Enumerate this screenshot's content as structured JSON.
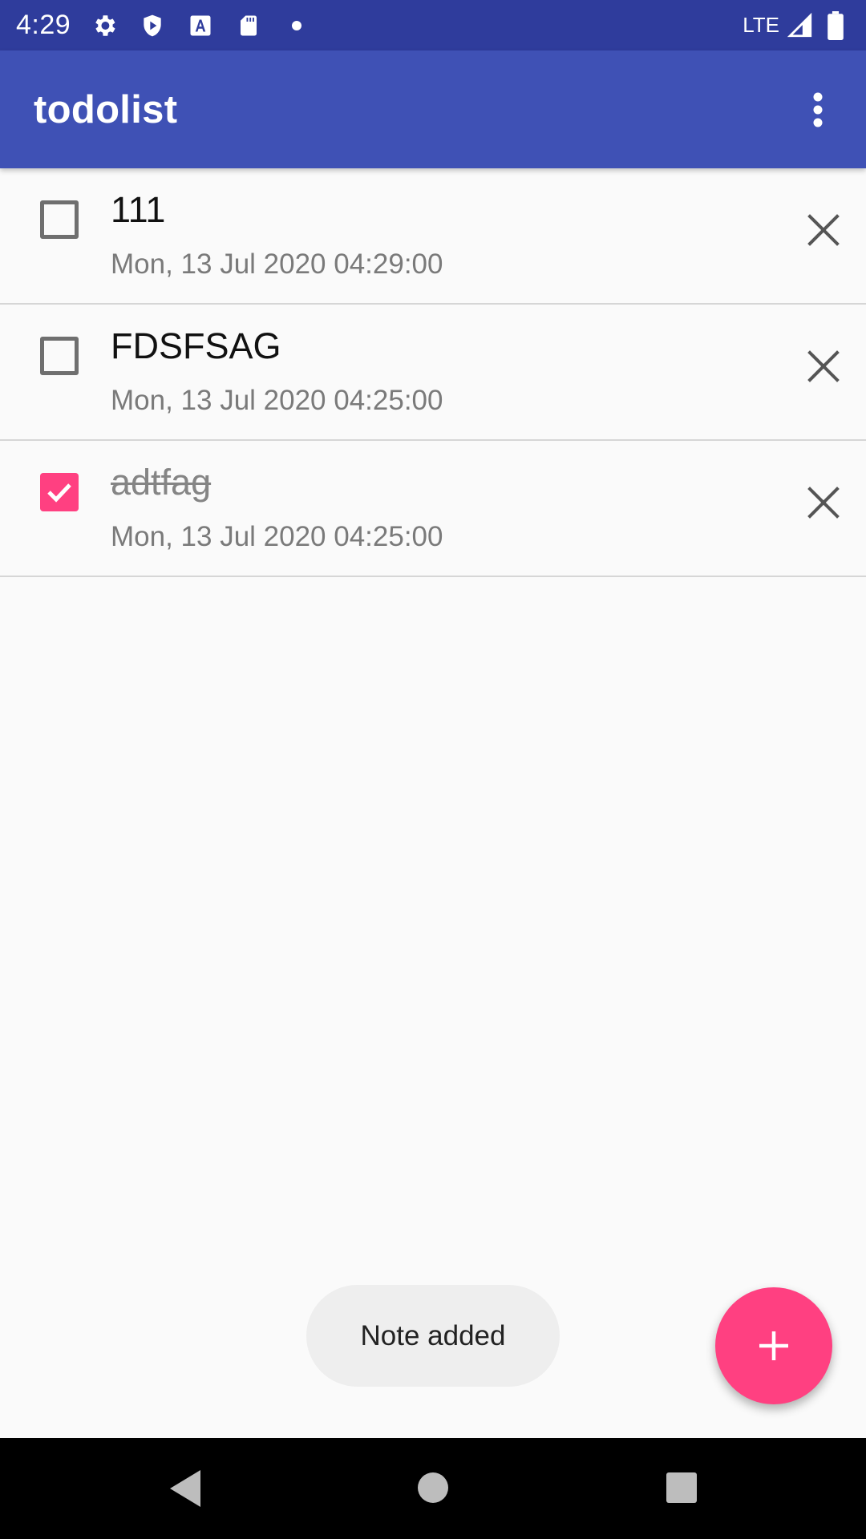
{
  "status_bar": {
    "time": "4:29",
    "network": "LTE",
    "icons": [
      "gear-icon",
      "shield-play-icon",
      "a-font-icon",
      "sd-card-icon",
      "dot-icon",
      "signal-icon",
      "battery-icon"
    ]
  },
  "app_bar": {
    "title": "todolist",
    "menu_icon": "more-vert-icon"
  },
  "todos": [
    {
      "title": "111",
      "date": "Mon, 13 Jul 2020 04:29:00",
      "done": false
    },
    {
      "title": "FDSFSAG",
      "date": "Mon, 13 Jul 2020 04:25:00",
      "done": false
    },
    {
      "title": "adtfag",
      "date": "Mon, 13 Jul 2020 04:25:00",
      "done": true
    }
  ],
  "toast": {
    "text": "Note added"
  },
  "fab": {
    "icon": "plus-icon"
  },
  "nav": {
    "icons": [
      "back-icon",
      "home-icon",
      "recents-icon"
    ]
  },
  "colors": {
    "status_bar": "#2f3c9c",
    "app_bar": "#3f51b5",
    "accent": "#ff4081",
    "background": "#fafafa"
  }
}
